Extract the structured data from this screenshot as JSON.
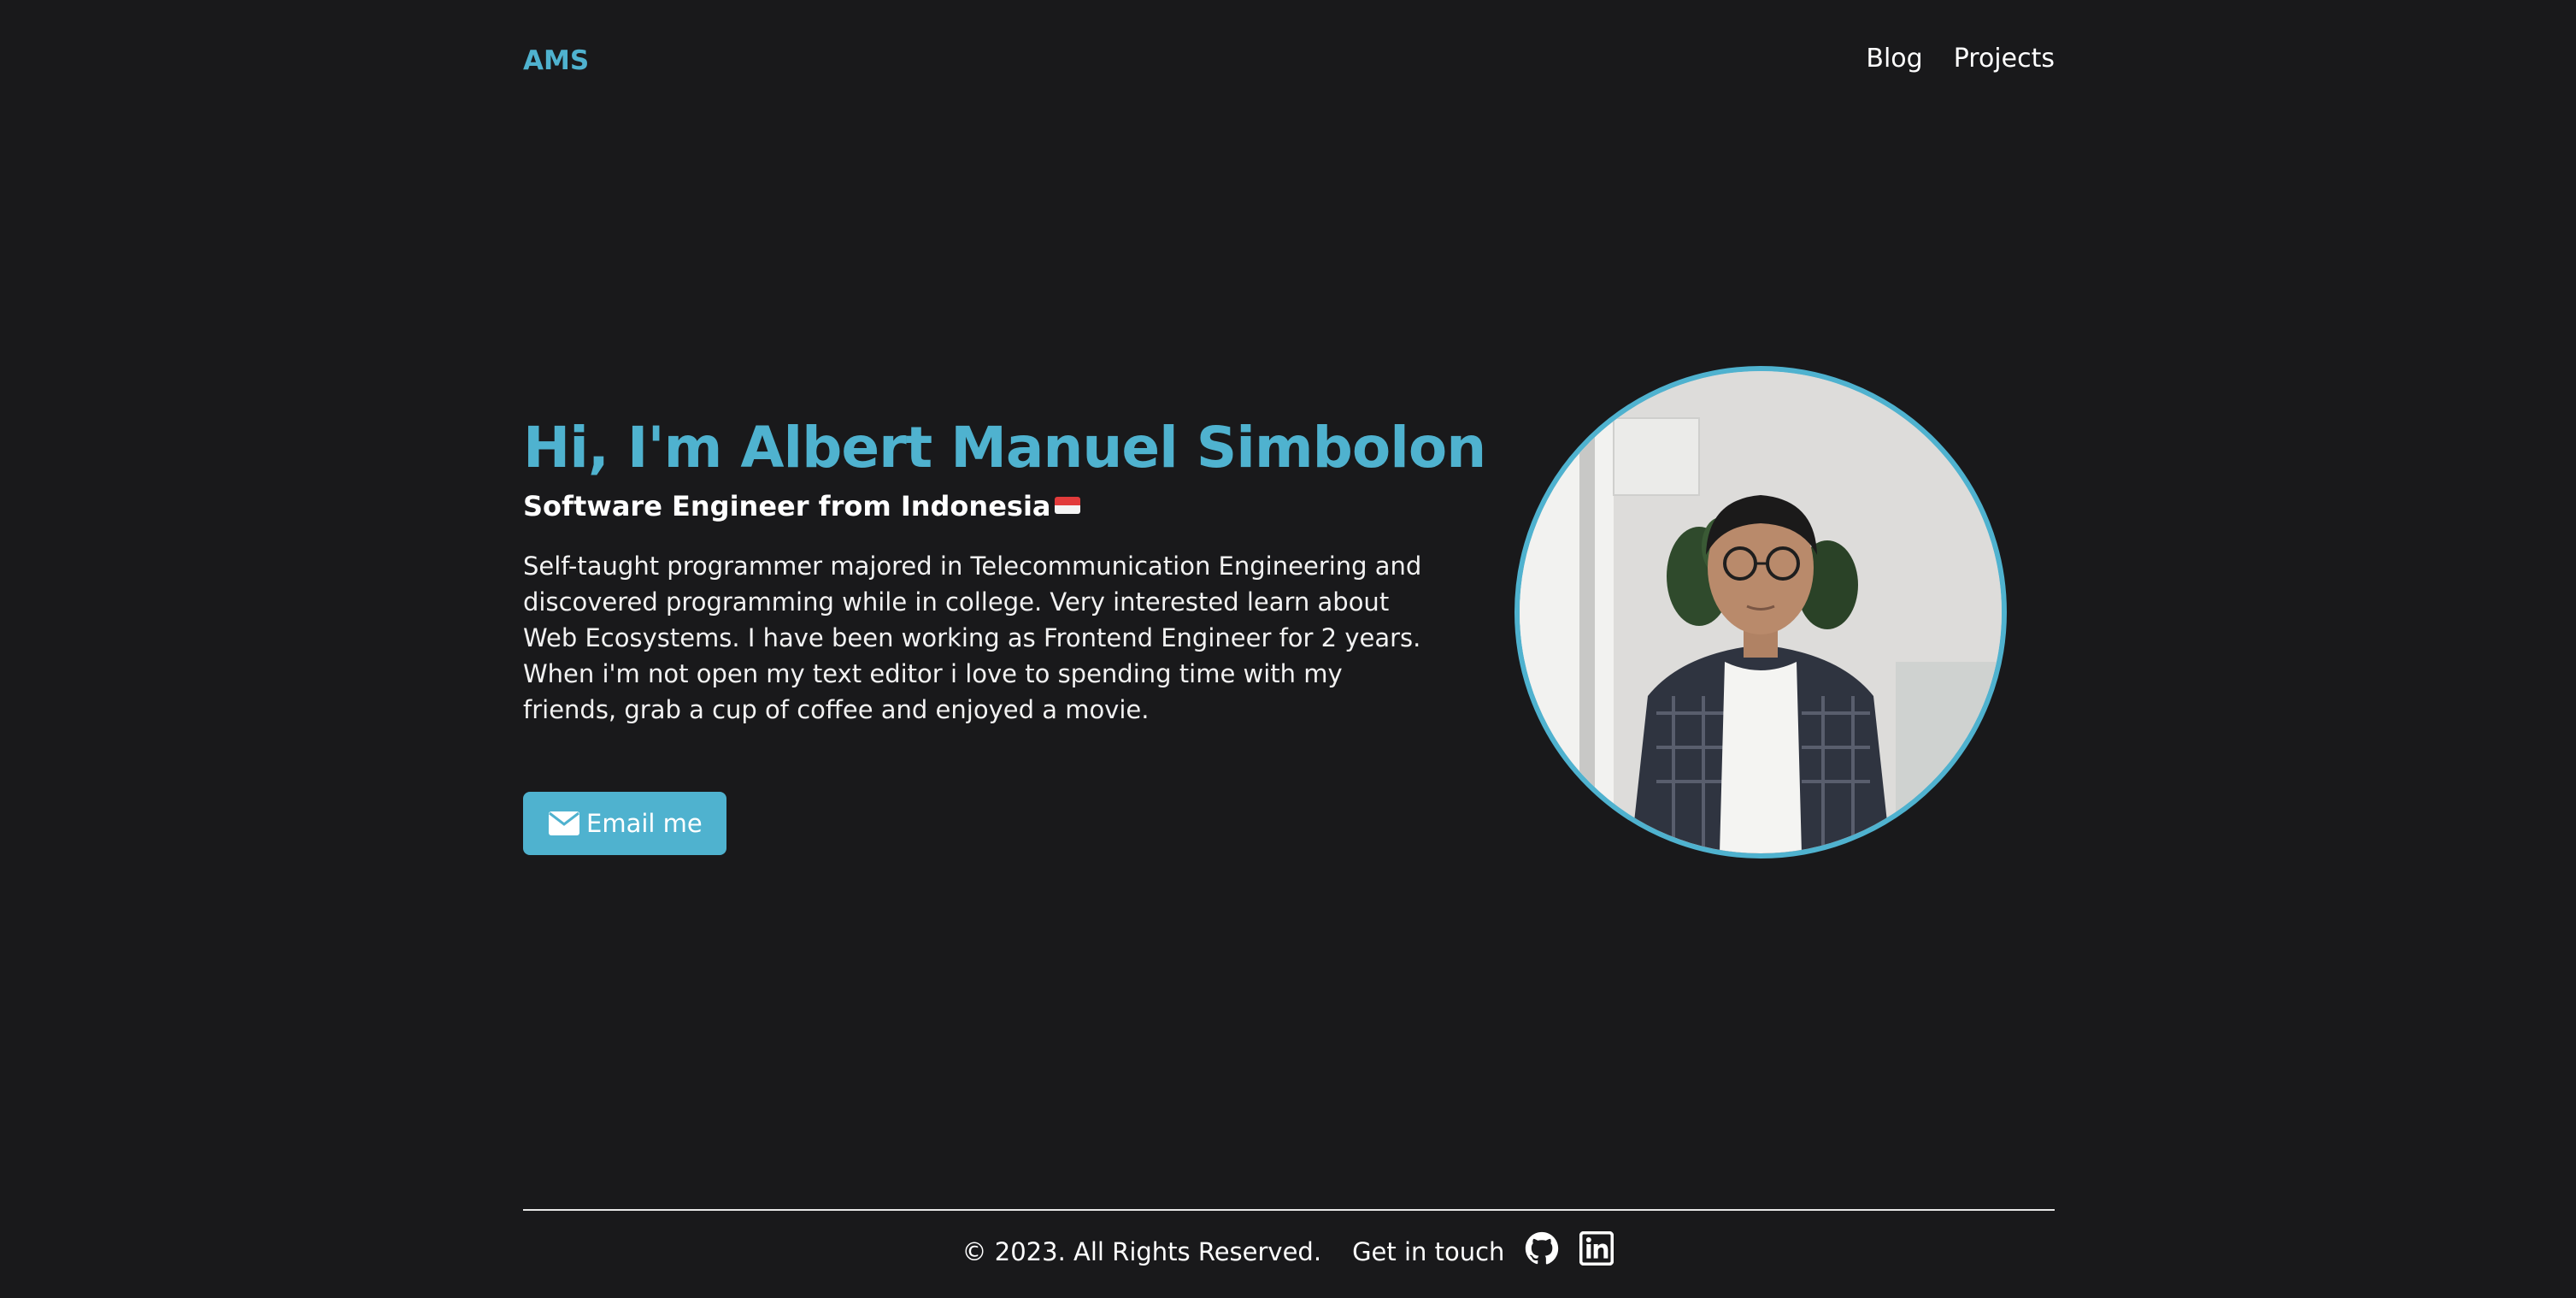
{
  "header": {
    "logo": "AMS",
    "nav": [
      {
        "label": "Blog"
      },
      {
        "label": "Projects"
      }
    ]
  },
  "hero": {
    "title": "Hi, I'm Albert Manuel Simbolon",
    "subtitle": "Software Engineer from Indonesia",
    "flag_icon": "indonesia-flag-icon",
    "bio": "Self-taught programmer majored in Telecommunication Engineering and discovered programming while in college. Very interested learn about Web Ecosystems. I have been working as Frontend Engineer for 2 years. When i'm not open my text editor i love to spending time with my friends, grab a cup of coffee and enjoyed a movie.",
    "email_button": "Email me",
    "email_icon": "envelope-icon"
  },
  "profile_photo": {
    "alt": "Albert Manuel Simbolon"
  },
  "footer": {
    "copyright": "© 2023. All Rights Reserved.",
    "get_in_touch": "Get in touch",
    "icons": [
      "github-icon",
      "linkedin-icon"
    ]
  },
  "colors": {
    "background": "#19191b",
    "accent": "#4fb2cf",
    "text": "#ffffff"
  }
}
